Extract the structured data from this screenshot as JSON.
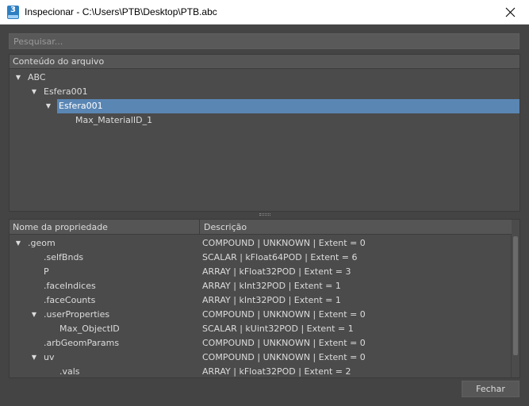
{
  "window": {
    "app_icon_text": "3",
    "title": "Inspecionar - C:\\Users\\PTB\\Desktop\\PTB.abc",
    "close_icon": "close-icon"
  },
  "search": {
    "placeholder": "Pesquisar..."
  },
  "tree": {
    "header": "Conteúdo do arquivo",
    "nodes": [
      {
        "label": "ABC",
        "expanded": true,
        "depth": 0
      },
      {
        "label": "Esfera001",
        "expanded": true,
        "depth": 1
      },
      {
        "label": "Esfera001",
        "expanded": true,
        "depth": 2,
        "selected": true
      },
      {
        "label": "Max_MaterialID_1",
        "expanded": null,
        "depth": 3
      }
    ]
  },
  "properties": {
    "columns": [
      "Nome da propriedade",
      "Descrição"
    ],
    "rows": [
      {
        "name": ".geom",
        "desc": "COMPOUND | UNKNOWN | Extent = 0",
        "depth": 0,
        "expanded": true
      },
      {
        "name": ".selfBnds",
        "desc": "SCALAR | kFloat64POD | Extent = 6",
        "depth": 1,
        "expanded": null
      },
      {
        "name": "P",
        "desc": "ARRAY | kFloat32POD | Extent = 3",
        "depth": 1,
        "expanded": null
      },
      {
        "name": ".faceIndices",
        "desc": "ARRAY | kInt32POD | Extent = 1",
        "depth": 1,
        "expanded": null
      },
      {
        "name": ".faceCounts",
        "desc": "ARRAY | kInt32POD | Extent = 1",
        "depth": 1,
        "expanded": null
      },
      {
        "name": ".userProperties",
        "desc": "COMPOUND | UNKNOWN | Extent = 0",
        "depth": 1,
        "expanded": true
      },
      {
        "name": "Max_ObjectID",
        "desc": "SCALAR | kUint32POD | Extent = 1",
        "depth": 2,
        "expanded": null
      },
      {
        "name": ".arbGeomParams",
        "desc": "COMPOUND | UNKNOWN | Extent = 0",
        "depth": 1,
        "expanded": null
      },
      {
        "name": "uv",
        "desc": "COMPOUND | UNKNOWN | Extent = 0",
        "depth": 1,
        "expanded": true
      },
      {
        "name": ".vals",
        "desc": "ARRAY | kFloat32POD | Extent = 2",
        "depth": 2,
        "expanded": null
      }
    ]
  },
  "footer": {
    "close_label": "Fechar"
  }
}
